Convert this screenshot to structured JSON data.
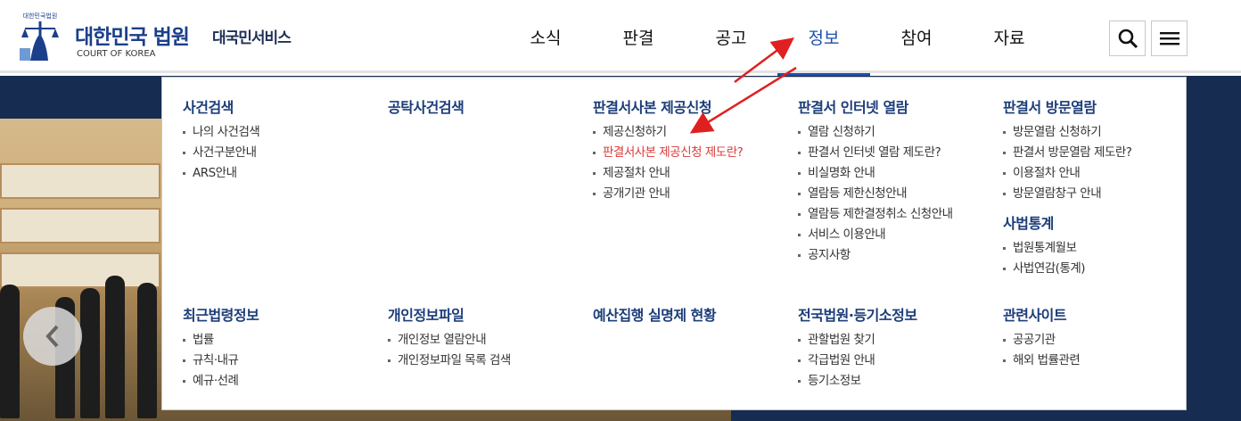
{
  "header": {
    "logo_text": "대한민국법원",
    "title": "대한민국 법원",
    "subtitle": "COURT OF KOREA",
    "site_name": "대국민서비스",
    "nav": [
      "소식",
      "판결",
      "공고",
      "정보",
      "참여",
      "자료"
    ],
    "active_nav": "정보"
  },
  "colors": {
    "brand": "#1b3f8b",
    "active": "#1d4fb0",
    "highlight": "#d93a3a",
    "arrow": "#e02020",
    "navy": "#162c50"
  },
  "menu": {
    "col1": {
      "title": "사건검색",
      "items": [
        "나의 사건검색",
        "사건구분안내",
        "ARS안내"
      ]
    },
    "col2": {
      "title": "공탁사건검색",
      "items": []
    },
    "col3": {
      "title": "판결서사본 제공신청",
      "items": [
        "제공신청하기",
        "판결서사본 제공신청 제도란?",
        "제공절차 안내",
        "공개기관 안내"
      ]
    },
    "col4": {
      "title": "판결서 인터넷 열람",
      "items": [
        "열람 신청하기",
        "판결서 인터넷 열람 제도란?",
        "비실명화 안내",
        "열람등 제한신청안내",
        "열람등 제한결정취소 신청안내",
        "서비스 이용안내",
        "공지사항"
      ]
    },
    "col5": {
      "title": "판결서 방문열람",
      "items": [
        "방문열람 신청하기",
        "판결서 방문열람 제도란?",
        "이용절차 안내",
        "방문열람창구 안내"
      ]
    },
    "col5b": {
      "title": "사법통계",
      "items": [
        "법원통계월보",
        "사법연감(통계)"
      ]
    },
    "col6": {
      "title": "최근법령정보",
      "items": [
        "법률",
        "규칙·내규",
        "예규·선례"
      ]
    },
    "col7": {
      "title": "개인정보파일",
      "items": [
        "개인정보 열람안내",
        "개인정보파일 목록 검색"
      ]
    },
    "col8": {
      "title": "예산집행 실명제 현황",
      "items": []
    },
    "col9": {
      "title": "전국법원·등기소정보",
      "items": [
        "관할법원 찾기",
        "각급법원 안내",
        "등기소정보"
      ]
    },
    "col10": {
      "title": "관련사이트",
      "items": [
        "공공기관",
        "해외 법률관련"
      ]
    }
  },
  "icons": {
    "search": "search-icon",
    "menu": "hamburger-menu-icon",
    "prev": "chevron-left-icon"
  }
}
